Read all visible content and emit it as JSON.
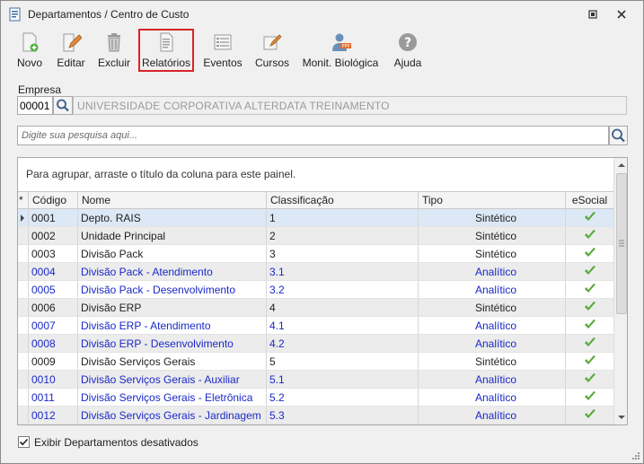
{
  "window": {
    "title": "Departamentos / Centro de Custo"
  },
  "toolbar": {
    "buttons": [
      {
        "label": "Novo",
        "icon": "new-document-icon"
      },
      {
        "label": "Editar",
        "icon": "edit-pencil-icon"
      },
      {
        "label": "Excluir",
        "icon": "trash-icon"
      },
      {
        "label": "Relatórios",
        "icon": "report-icon",
        "highlighted": true
      },
      {
        "label": "Eventos",
        "icon": "events-list-icon"
      },
      {
        "label": "Cursos",
        "icon": "courses-icon"
      },
      {
        "label": "Monit. Biológica",
        "icon": "ppp-person-icon"
      },
      {
        "label": "Ajuda",
        "icon": "help-icon"
      }
    ]
  },
  "empresa": {
    "label": "Empresa",
    "code": "00001",
    "name": "UNIVERSIDADE CORPORATIVA ALTERDATA TREINAMENTO"
  },
  "search": {
    "placeholder": "Digite sua pesquisa aqui..."
  },
  "grid": {
    "group_hint": "Para agrupar, arraste o título da coluna para este painel.",
    "columns": {
      "indicator": "*",
      "codigo": "Código",
      "nome": "Nome",
      "classificacao": "Classificação",
      "tipo": "Tipo",
      "esocial": "eSocial"
    },
    "rows": [
      {
        "codigo": "0001",
        "nome": "Depto. RAIS",
        "classificacao": "1",
        "tipo": "Sintético",
        "esocial": true
      },
      {
        "codigo": "0002",
        "nome": "Unidade Principal",
        "classificacao": "2",
        "tipo": "Sintético",
        "esocial": true
      },
      {
        "codigo": "0003",
        "nome": "Divisão Pack",
        "classificacao": "3",
        "tipo": "Sintético",
        "esocial": true
      },
      {
        "codigo": "0004",
        "nome": "Divisão Pack - Atendimento",
        "classificacao": "3.1",
        "tipo": "Analítico",
        "esocial": true
      },
      {
        "codigo": "0005",
        "nome": "Divisão Pack - Desenvolvimento",
        "classificacao": "3.2",
        "tipo": "Analítico",
        "esocial": true
      },
      {
        "codigo": "0006",
        "nome": "Divisão ERP",
        "classificacao": "4",
        "tipo": "Sintético",
        "esocial": true
      },
      {
        "codigo": "0007",
        "nome": "Divisão ERP - Atendimento",
        "classificacao": "4.1",
        "tipo": "Analítico",
        "esocial": true
      },
      {
        "codigo": "0008",
        "nome": "Divisão ERP - Desenvolvimento",
        "classificacao": "4.2",
        "tipo": "Analítico",
        "esocial": true
      },
      {
        "codigo": "0009",
        "nome": "Divisão Serviços Gerais",
        "classificacao": "5",
        "tipo": "Sintético",
        "esocial": true
      },
      {
        "codigo": "0010",
        "nome": "Divisão Serviços Gerais - Auxiliar",
        "classificacao": "5.1",
        "tipo": "Analítico",
        "esocial": true
      },
      {
        "codigo": "0011",
        "nome": "Divisão Serviços Gerais - Eletrônica",
        "classificacao": "5.2",
        "tipo": "Analítico",
        "esocial": true
      },
      {
        "codigo": "0012",
        "nome": "Divisão Serviços Gerais - Jardinagem",
        "classificacao": "5.3",
        "tipo": "Analítico",
        "esocial": true
      }
    ]
  },
  "footer": {
    "show_inactive_label": "Exibir Departamentos desativados",
    "show_inactive_checked": true
  },
  "colors": {
    "analytic_text": "#1b28c8",
    "highlight_border": "#d8232a",
    "check_green": "#5aa83a"
  }
}
